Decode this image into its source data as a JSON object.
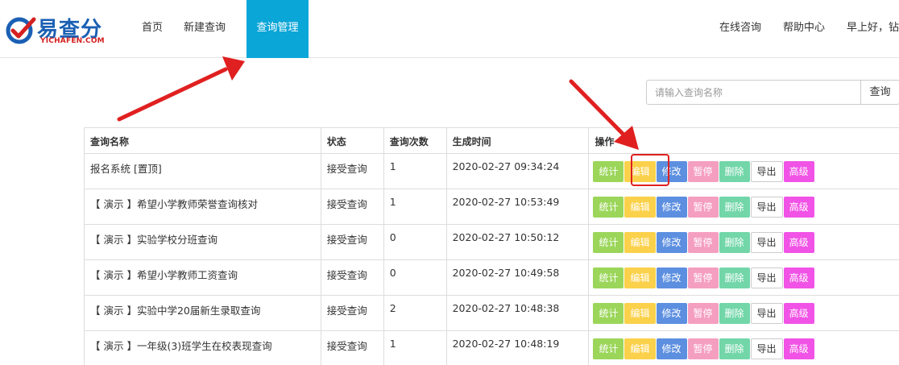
{
  "header": {
    "logo_text": "易查分",
    "logo_subtext": "YICHAFEN.COM",
    "nav": [
      {
        "label": "首页"
      },
      {
        "label": "新建查询"
      },
      {
        "label": "查询管理",
        "active": true
      }
    ],
    "right_nav": [
      {
        "label": "在线咨询"
      },
      {
        "label": "帮助中心"
      },
      {
        "label": "早上好，钻"
      }
    ]
  },
  "search": {
    "placeholder": "请输入查询名称",
    "value": "",
    "button_label": "查询"
  },
  "table": {
    "columns": [
      "查询名称",
      "状态",
      "查询次数",
      "生成时间",
      "操作"
    ],
    "action_labels": {
      "stat": "统计",
      "edit": "编辑",
      "modify": "修改",
      "pause": "暂停",
      "delete": "删除",
      "export": "导出",
      "advanced": "高级"
    },
    "rows": [
      {
        "name": "报名系统 [置顶]",
        "status": "接受查询",
        "count": "1",
        "time": "2020-02-27 09:34:24"
      },
      {
        "name": "【 演示 】希望小学教师荣誉查询核对",
        "status": "接受查询",
        "count": "1",
        "time": "2020-02-27 10:53:49"
      },
      {
        "name": "【 演示 】实验学校分班查询",
        "status": "接受查询",
        "count": "0",
        "time": "2020-02-27 10:50:12"
      },
      {
        "name": "【 演示 】希望小学教师工资查询",
        "status": "接受查询",
        "count": "0",
        "time": "2020-02-27 10:49:58"
      },
      {
        "name": "【 演示 】实验中学20届新生录取查询",
        "status": "接受查询",
        "count": "2",
        "time": "2020-02-27 10:48:38"
      },
      {
        "name": "【 演示 】一年级(3)班学生在校表现查询",
        "status": "接受查询",
        "count": "1",
        "time": "2020-02-27 10:48:19"
      }
    ]
  },
  "colors": {
    "nav_active": "#0aa6d8",
    "stat": "#9bd65a",
    "edit": "#fbd14b",
    "modify": "#5d8fe0",
    "pause": "#f59fc0",
    "delete": "#72d6a9",
    "advanced": "#f153e6",
    "annotation": "#e02020"
  }
}
